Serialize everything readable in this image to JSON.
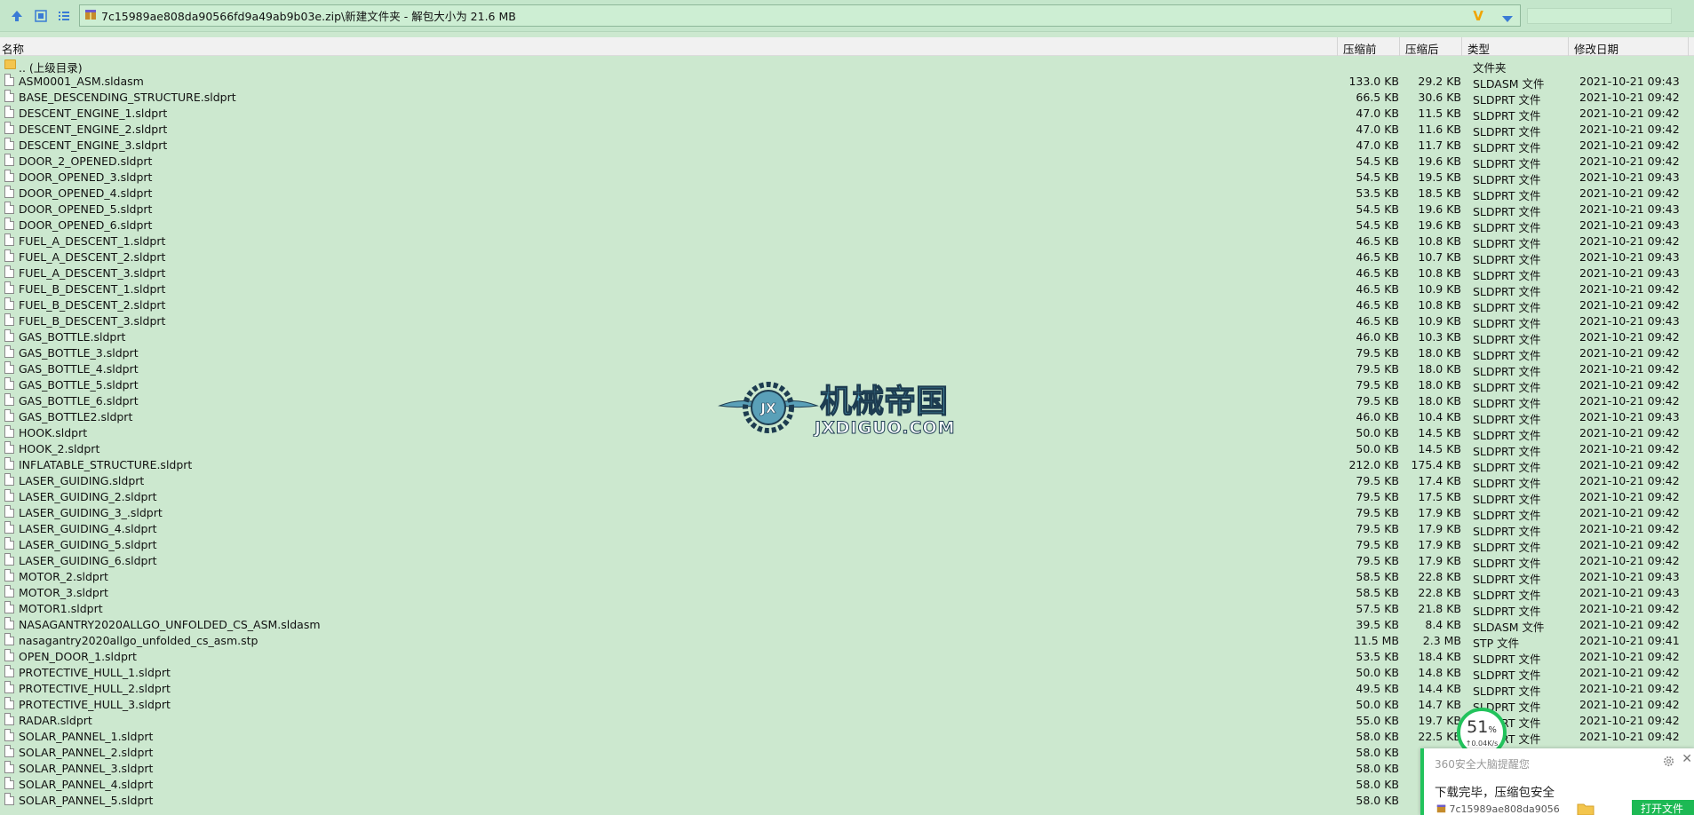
{
  "toolbar": {
    "up_icon": "up-arrow-icon",
    "view_icon": "thumbnail-view-icon",
    "list_icon": "list-view-icon",
    "address_path": "7c15989ae808da90566fd9a49ab9b03e.zip\\新建文件夹 - 解包大小为 21.6 MB",
    "logo_letter": "V"
  },
  "header": {
    "name": "名称",
    "before": "压缩前",
    "after": "压缩后",
    "type": "类型",
    "mtime": "修改日期"
  },
  "rows": [
    {
      "name": ".. (上级目录)",
      "before": "",
      "after": "",
      "type": "文件夹",
      "mtime": "",
      "icon": "folder"
    },
    {
      "name": "ASM0001_ASM.sldasm",
      "before": "133.0 KB",
      "after": "29.2 KB",
      "type": "SLDASM 文件",
      "mtime": "2021-10-21 09:43",
      "icon": "file"
    },
    {
      "name": "BASE_DESCENDING_STRUCTURE.sldprt",
      "before": "66.5 KB",
      "after": "30.6 KB",
      "type": "SLDPRT 文件",
      "mtime": "2021-10-21 09:42",
      "icon": "file"
    },
    {
      "name": "DESCENT_ENGINE_1.sldprt",
      "before": "47.0 KB",
      "after": "11.5 KB",
      "type": "SLDPRT 文件",
      "mtime": "2021-10-21 09:42",
      "icon": "file"
    },
    {
      "name": "DESCENT_ENGINE_2.sldprt",
      "before": "47.0 KB",
      "after": "11.6 KB",
      "type": "SLDPRT 文件",
      "mtime": "2021-10-21 09:42",
      "icon": "file"
    },
    {
      "name": "DESCENT_ENGINE_3.sldprt",
      "before": "47.0 KB",
      "after": "11.7 KB",
      "type": "SLDPRT 文件",
      "mtime": "2021-10-21 09:42",
      "icon": "file"
    },
    {
      "name": "DOOR_2_OPENED.sldprt",
      "before": "54.5 KB",
      "after": "19.6 KB",
      "type": "SLDPRT 文件",
      "mtime": "2021-10-21 09:42",
      "icon": "file"
    },
    {
      "name": "DOOR_OPENED_3.sldprt",
      "before": "54.5 KB",
      "after": "19.5 KB",
      "type": "SLDPRT 文件",
      "mtime": "2021-10-21 09:43",
      "icon": "file"
    },
    {
      "name": "DOOR_OPENED_4.sldprt",
      "before": "53.5 KB",
      "after": "18.5 KB",
      "type": "SLDPRT 文件",
      "mtime": "2021-10-21 09:42",
      "icon": "file"
    },
    {
      "name": "DOOR_OPENED_5.sldprt",
      "before": "54.5 KB",
      "after": "19.6 KB",
      "type": "SLDPRT 文件",
      "mtime": "2021-10-21 09:43",
      "icon": "file"
    },
    {
      "name": "DOOR_OPENED_6.sldprt",
      "before": "54.5 KB",
      "after": "19.6 KB",
      "type": "SLDPRT 文件",
      "mtime": "2021-10-21 09:43",
      "icon": "file"
    },
    {
      "name": "FUEL_A_DESCENT_1.sldprt",
      "before": "46.5 KB",
      "after": "10.8 KB",
      "type": "SLDPRT 文件",
      "mtime": "2021-10-21 09:42",
      "icon": "file"
    },
    {
      "name": "FUEL_A_DESCENT_2.sldprt",
      "before": "46.5 KB",
      "after": "10.7 KB",
      "type": "SLDPRT 文件",
      "mtime": "2021-10-21 09:43",
      "icon": "file"
    },
    {
      "name": "FUEL_A_DESCENT_3.sldprt",
      "before": "46.5 KB",
      "after": "10.8 KB",
      "type": "SLDPRT 文件",
      "mtime": "2021-10-21 09:43",
      "icon": "file"
    },
    {
      "name": "FUEL_B_DESCENT_1.sldprt",
      "before": "46.5 KB",
      "after": "10.9 KB",
      "type": "SLDPRT 文件",
      "mtime": "2021-10-21 09:42",
      "icon": "file"
    },
    {
      "name": "FUEL_B_DESCENT_2.sldprt",
      "before": "46.5 KB",
      "after": "10.8 KB",
      "type": "SLDPRT 文件",
      "mtime": "2021-10-21 09:42",
      "icon": "file"
    },
    {
      "name": "FUEL_B_DESCENT_3.sldprt",
      "before": "46.5 KB",
      "after": "10.9 KB",
      "type": "SLDPRT 文件",
      "mtime": "2021-10-21 09:43",
      "icon": "file"
    },
    {
      "name": "GAS_BOTTLE.sldprt",
      "before": "46.0 KB",
      "after": "10.3 KB",
      "type": "SLDPRT 文件",
      "mtime": "2021-10-21 09:42",
      "icon": "file"
    },
    {
      "name": "GAS_BOTTLE_3.sldprt",
      "before": "79.5 KB",
      "after": "18.0 KB",
      "type": "SLDPRT 文件",
      "mtime": "2021-10-21 09:42",
      "icon": "file"
    },
    {
      "name": "GAS_BOTTLE_4.sldprt",
      "before": "79.5 KB",
      "after": "18.0 KB",
      "type": "SLDPRT 文件",
      "mtime": "2021-10-21 09:42",
      "icon": "file"
    },
    {
      "name": "GAS_BOTTLE_5.sldprt",
      "before": "79.5 KB",
      "after": "18.0 KB",
      "type": "SLDPRT 文件",
      "mtime": "2021-10-21 09:42",
      "icon": "file"
    },
    {
      "name": "GAS_BOTTLE_6.sldprt",
      "before": "79.5 KB",
      "after": "18.0 KB",
      "type": "SLDPRT 文件",
      "mtime": "2021-10-21 09:42",
      "icon": "file"
    },
    {
      "name": "GAS_BOTTLE2.sldprt",
      "before": "46.0 KB",
      "after": "10.4 KB",
      "type": "SLDPRT 文件",
      "mtime": "2021-10-21 09:43",
      "icon": "file"
    },
    {
      "name": "HOOK.sldprt",
      "before": "50.0 KB",
      "after": "14.5 KB",
      "type": "SLDPRT 文件",
      "mtime": "2021-10-21 09:42",
      "icon": "file"
    },
    {
      "name": "HOOK_2.sldprt",
      "before": "50.0 KB",
      "after": "14.5 KB",
      "type": "SLDPRT 文件",
      "mtime": "2021-10-21 09:42",
      "icon": "file"
    },
    {
      "name": "INFLATABLE_STRUCTURE.sldprt",
      "before": "212.0 KB",
      "after": "175.4 KB",
      "type": "SLDPRT 文件",
      "mtime": "2021-10-21 09:42",
      "icon": "file"
    },
    {
      "name": "LASER_GUIDING.sldprt",
      "before": "79.5 KB",
      "after": "17.4 KB",
      "type": "SLDPRT 文件",
      "mtime": "2021-10-21 09:42",
      "icon": "file"
    },
    {
      "name": "LASER_GUIDING_2.sldprt",
      "before": "79.5 KB",
      "after": "17.5 KB",
      "type": "SLDPRT 文件",
      "mtime": "2021-10-21 09:42",
      "icon": "file"
    },
    {
      "name": "LASER_GUIDING_3_.sldprt",
      "before": "79.5 KB",
      "after": "17.9 KB",
      "type": "SLDPRT 文件",
      "mtime": "2021-10-21 09:42",
      "icon": "file"
    },
    {
      "name": "LASER_GUIDING_4.sldprt",
      "before": "79.5 KB",
      "after": "17.9 KB",
      "type": "SLDPRT 文件",
      "mtime": "2021-10-21 09:42",
      "icon": "file"
    },
    {
      "name": "LASER_GUIDING_5.sldprt",
      "before": "79.5 KB",
      "after": "17.9 KB",
      "type": "SLDPRT 文件",
      "mtime": "2021-10-21 09:42",
      "icon": "file"
    },
    {
      "name": "LASER_GUIDING_6.sldprt",
      "before": "79.5 KB",
      "after": "17.9 KB",
      "type": "SLDPRT 文件",
      "mtime": "2021-10-21 09:42",
      "icon": "file"
    },
    {
      "name": "MOTOR_2.sldprt",
      "before": "58.5 KB",
      "after": "22.8 KB",
      "type": "SLDPRT 文件",
      "mtime": "2021-10-21 09:43",
      "icon": "file"
    },
    {
      "name": "MOTOR_3.sldprt",
      "before": "58.5 KB",
      "after": "22.8 KB",
      "type": "SLDPRT 文件",
      "mtime": "2021-10-21 09:43",
      "icon": "file"
    },
    {
      "name": "MOTOR1.sldprt",
      "before": "57.5 KB",
      "after": "21.8 KB",
      "type": "SLDPRT 文件",
      "mtime": "2021-10-21 09:42",
      "icon": "file"
    },
    {
      "name": "NASAGANTRY2020ALLGO_UNFOLDED_CS_ASM.sldasm",
      "before": "39.5 KB",
      "after": "8.4 KB",
      "type": "SLDASM 文件",
      "mtime": "2021-10-21 09:42",
      "icon": "file"
    },
    {
      "name": "nasagantry2020allgo_unfolded_cs_asm.stp",
      "before": "11.5 MB",
      "after": "2.3 MB",
      "type": "STP 文件",
      "mtime": "2021-10-21 09:41",
      "icon": "file"
    },
    {
      "name": "OPEN_DOOR_1.sldprt",
      "before": "53.5 KB",
      "after": "18.4 KB",
      "type": "SLDPRT 文件",
      "mtime": "2021-10-21 09:42",
      "icon": "file"
    },
    {
      "name": "PROTECTIVE_HULL_1.sldprt",
      "before": "50.0 KB",
      "after": "14.8 KB",
      "type": "SLDPRT 文件",
      "mtime": "2021-10-21 09:42",
      "icon": "file"
    },
    {
      "name": "PROTECTIVE_HULL_2.sldprt",
      "before": "49.5 KB",
      "after": "14.4 KB",
      "type": "SLDPRT 文件",
      "mtime": "2021-10-21 09:42",
      "icon": "file"
    },
    {
      "name": "PROTECTIVE_HULL_3.sldprt",
      "before": "50.0 KB",
      "after": "14.7 KB",
      "type": "SLDPRT 文件",
      "mtime": "2021-10-21 09:42",
      "icon": "file"
    },
    {
      "name": "RADAR.sldprt",
      "before": "55.0 KB",
      "after": "19.7 KB",
      "type": "SLDPRT 文件",
      "mtime": "2021-10-21 09:42",
      "icon": "file"
    },
    {
      "name": "SOLAR_PANNEL_1.sldprt",
      "before": "58.0 KB",
      "after": "22.5 KB",
      "type": "SLDPRT 文件",
      "mtime": "2021-10-21 09:42",
      "icon": "file"
    },
    {
      "name": "SOLAR_PANNEL_2.sldprt",
      "before": "58.0 KB",
      "after": "",
      "type": "",
      "mtime": "",
      "icon": "file"
    },
    {
      "name": "SOLAR_PANNEL_3.sldprt",
      "before": "58.0 KB",
      "after": "",
      "type": "",
      "mtime": "",
      "icon": "file"
    },
    {
      "name": "SOLAR_PANNEL_4.sldprt",
      "before": "58.0 KB",
      "after": "",
      "type": "",
      "mtime": "",
      "icon": "file"
    },
    {
      "name": "SOLAR_PANNEL_5.sldprt",
      "before": "58.0 KB",
      "after": "",
      "type": "",
      "mtime": "",
      "icon": "file"
    }
  ],
  "watermark": {
    "title": "机械帝国",
    "subtitle": "JXDIGUO.COM",
    "emblem_letters": "JX"
  },
  "progress": {
    "percent": "51",
    "percent_sign": "%",
    "speed": "↑0.04K/s",
    "value": 0.51
  },
  "notice": {
    "title": "360安全大脑提醒您",
    "message": "下载完毕，压缩包安全",
    "filename": "7c15989ae808da9056",
    "open_button": "打开文件",
    "gear_icon": "gear-icon",
    "close_icon": "close-icon"
  },
  "colors": {
    "background": "#cce8cf",
    "accent_green": "#22c35c",
    "header_bg": "#f1f1f1"
  }
}
